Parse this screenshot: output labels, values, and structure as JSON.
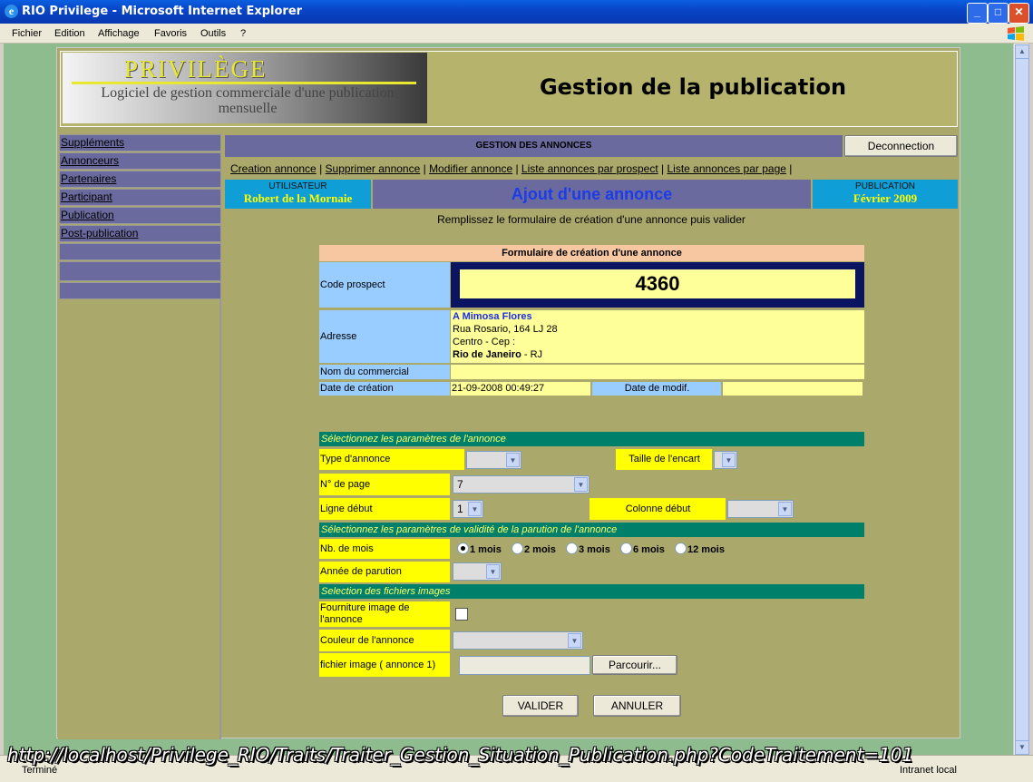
{
  "window": {
    "title": "RIO Privilege - Microsoft Internet Explorer"
  },
  "menu": [
    "Fichier",
    "Edition",
    "Affichage",
    "Favoris",
    "Outils",
    "?"
  ],
  "logo": {
    "brand": "PRIVILÈGE",
    "subtitle": "Logiciel de gestion commerciale d'une publication mensuelle"
  },
  "page_title": "Gestion de la publication",
  "nav": [
    "Suppléments",
    "Annonceurs",
    "Partenaires",
    "Participant",
    "Publication",
    "Post-publication"
  ],
  "header": {
    "section": "GESTION DES ANNONCES",
    "disconnect": "Deconnection"
  },
  "links": [
    "Creation annonce",
    "Supprimer annonce",
    "Modifier annonce",
    "Liste annonces par prospect",
    "Liste annonces par page"
  ],
  "user": {
    "label": "UTILISATEUR",
    "name": "Robert de la Mornaie"
  },
  "action_title": "Ajout d'une annonce",
  "publication": {
    "label": "PUBLICATION",
    "value": "Février 2009"
  },
  "instruction": "Remplissez le formulaire de création d'une annonce puis valider",
  "form": {
    "title": "Formulaire de création d'une annonce",
    "code_label": "Code prospect",
    "code_value": "4360",
    "address_label": "Adresse",
    "address": {
      "name": "A Mimosa Flores",
      "line1": "Rua Rosario, 164 LJ 28",
      "line2": "Centro - Cep :",
      "city": "Rio de Janeiro",
      "state": "- RJ"
    },
    "commercial_label": "Nom du commercial",
    "created_label": "Date de création",
    "created_value": "21-09-2008 00:49:27",
    "modified_label": "Date de modif."
  },
  "params": {
    "section": "Sélectionnez les paramètres de l'annonce",
    "type_label": "Type d'annonce",
    "size_label": "Taille de l'encart",
    "page_label": "N° de page",
    "page_value": "7",
    "line_label": "Ligne début",
    "line_value": "1",
    "column_label": "Colonne début"
  },
  "validity": {
    "section": "Sélectionnez les paramètres de validité de la parution de l'annonce",
    "months_label": "Nb. de mois",
    "months_options": [
      "1 mois",
      "2 mois",
      "3 mois",
      "6 mois",
      "12 mois"
    ],
    "year_label": "Année de parution"
  },
  "images": {
    "section": "Selection des fichiers images",
    "supply_label": "Fourniture image de l'annonce",
    "color_label": "Couleur de l'annonce",
    "file_label": "fichier image ( annonce 1)",
    "browse": "Parcourir..."
  },
  "actions": {
    "validate": "VALIDER",
    "cancel": "ANNULER"
  },
  "status": {
    "left": "Terminé",
    "right": "Intranet local",
    "url_overlay": "http://localhost/Privilege_RIO/Traits/Traiter_Gestion_Situation_Publication.php?CodeTraitement=101"
  }
}
